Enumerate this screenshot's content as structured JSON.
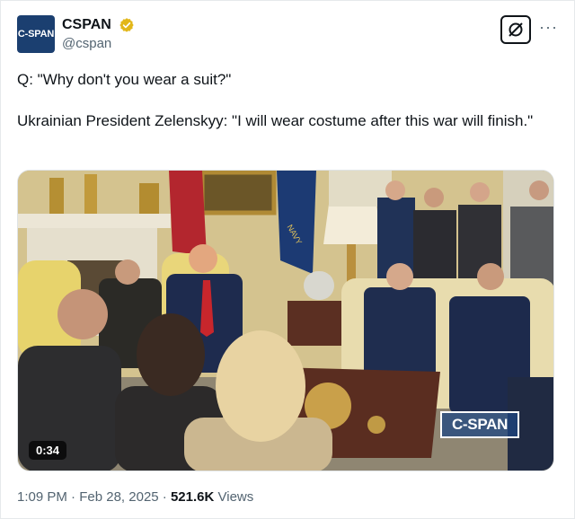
{
  "author": {
    "avatar_text": "C-SPAN",
    "display_name": "CSPAN",
    "handle": "@cspan",
    "verified_color": "#e2b719"
  },
  "header": {
    "grok_icon": "grok-icon",
    "more_label": "···"
  },
  "tweet": {
    "line1": "Q: \"Why don't you wear a suit?\"",
    "line2": "Ukrainian President Zelenskyy: \"I will wear costume after this war will finish.\""
  },
  "media": {
    "duration": "0:34",
    "watermark": "C-SPAN",
    "flag_text": "NAVY"
  },
  "meta": {
    "time": "1:09 PM",
    "separator1": " · ",
    "date": "Feb 28, 2025",
    "separator2": " · ",
    "views_count": "521.6K",
    "views_label": " Views"
  }
}
